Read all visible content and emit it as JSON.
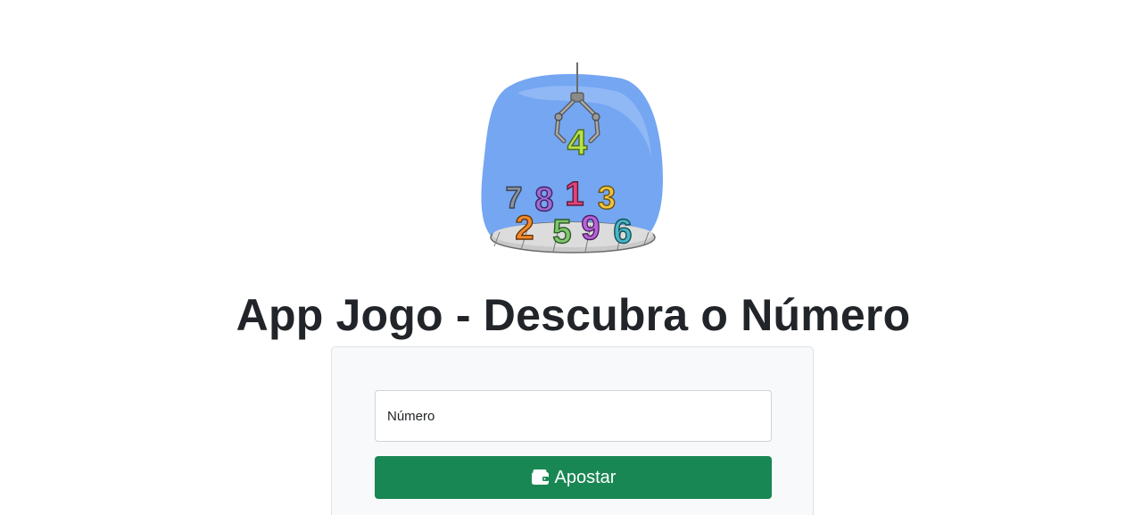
{
  "header": {
    "title": "App Jogo - Descubra o Número",
    "hero_icon": "number-claw-machine-illustration",
    "hero_numbers": [
      "4",
      "7",
      "8",
      "1",
      "3",
      "2",
      "5",
      "9",
      "6"
    ]
  },
  "form": {
    "number_input": {
      "placeholder": "Número",
      "value": ""
    },
    "bet_button": {
      "label": "Apostar",
      "icon": "wallet-icon"
    }
  },
  "colors": {
    "accent_button": "#198754",
    "card_background": "#f8f9fa",
    "hero_blob": "#74a6f2",
    "title_text": "#212529"
  }
}
